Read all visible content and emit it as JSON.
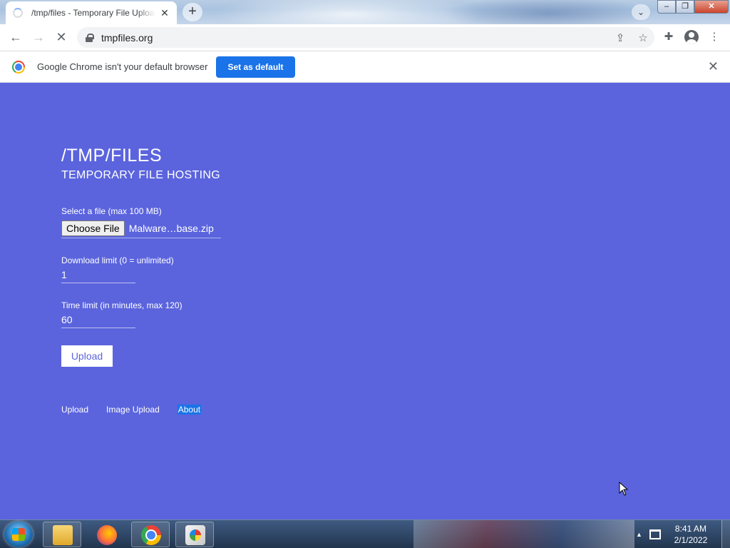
{
  "browser": {
    "tab_title": "/tmp/files - Temporary File Upload",
    "tab_close": "✕",
    "new_tab": "+",
    "url": "tmpfiles.org",
    "window_controls": {
      "minimize": "‒",
      "restore": "❐",
      "close": "✕"
    }
  },
  "infobar": {
    "message": "Google Chrome isn't your default browser",
    "set_default_label": "Set as default",
    "close": "✕"
  },
  "page": {
    "title": "/TMP/FILES",
    "subtitle": "TEMPORARY FILE HOSTING",
    "file_label": "Select a file (max 100 MB)",
    "choose_file_label": "Choose File",
    "file_name": "Malware…base.zip",
    "download_limit_label": "Download limit (0 = unlimited)",
    "download_limit_value": "1",
    "time_limit_label": "Time limit (in minutes, max 120)",
    "time_limit_value": "60",
    "upload_button": "Upload",
    "footer_links": [
      "Upload",
      "Image Upload",
      "About"
    ]
  },
  "taskbar": {
    "apps": [
      "windows-explorer",
      "firefox",
      "chrome",
      "paint"
    ],
    "time": "8:41 AM",
    "date": "2/1/2022"
  },
  "colors": {
    "page_background": "#5b64dd",
    "accent": "#1a73e8"
  }
}
